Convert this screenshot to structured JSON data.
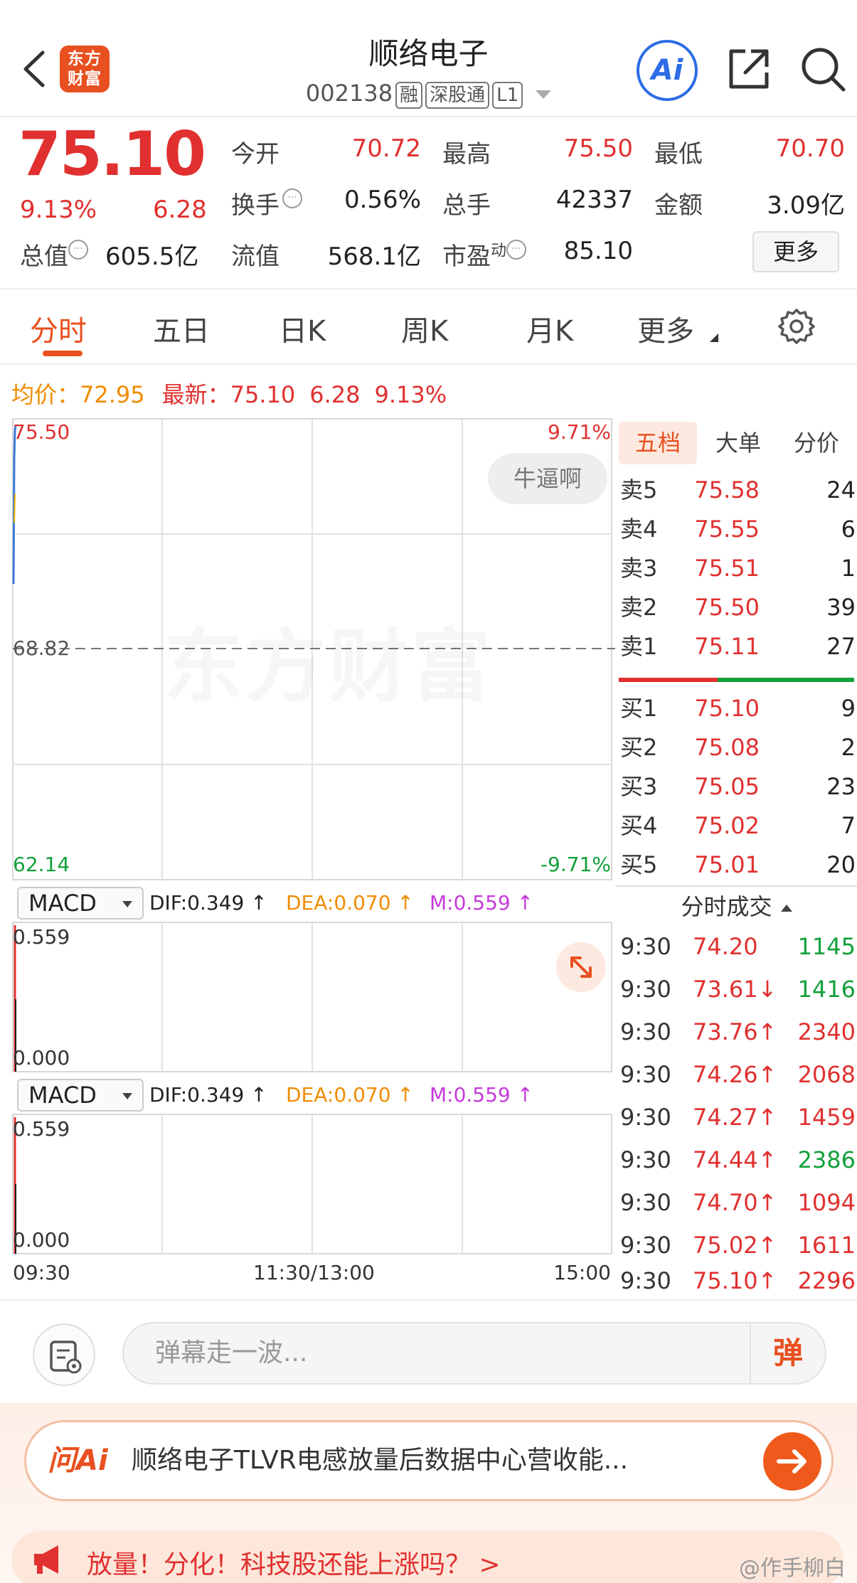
{
  "header": {
    "logo_text": "东方\n财富",
    "logo_line1": "东方",
    "logo_line2": "财富",
    "stock_name": "顺络电子",
    "stock_code": "002138",
    "tags": [
      "融",
      "深股通",
      "L1"
    ],
    "ai_label": "Ai"
  },
  "quote": {
    "price": "75.10",
    "change_pct": "9.13%",
    "change_amt": "6.28",
    "market_cap_label": "总值",
    "market_cap_value": "605.5亿",
    "fields": [
      {
        "label": "今开",
        "value": "70.72",
        "color": "red"
      },
      {
        "label": "最高",
        "value": "75.50",
        "color": "red"
      },
      {
        "label": "最低",
        "value": "70.70",
        "color": "red"
      },
      {
        "label": "换手",
        "value": "0.56%",
        "color": "black"
      },
      {
        "label": "总手",
        "value": "42337",
        "color": "black"
      },
      {
        "label": "金额",
        "value": "3.09亿",
        "color": "black"
      },
      {
        "label": "流值",
        "value": "568.1亿",
        "color": "black"
      },
      {
        "label": "市盈",
        "sup": "动",
        "value": "85.10",
        "color": "black"
      }
    ],
    "more_label": "更多"
  },
  "tabs": [
    "分时",
    "五日",
    "日K",
    "周K",
    "月K",
    "更多"
  ],
  "info_line": {
    "avg_label": "均价：",
    "avg_value": "72.95",
    "latest_label": "最新：",
    "latest_value": "75.10",
    "latest_chg": "6.28",
    "latest_pct": "9.13%"
  },
  "chart": {
    "y_high": "75.50",
    "y_mid": "68.82",
    "y_low": "62.14",
    "pct_high": "9.71%",
    "pct_low": "-9.71%",
    "comment_bubble": "牛逼啊",
    "watermark": "东方财富",
    "x_labels": [
      "09:30",
      "11:30/13:00",
      "15:00"
    ],
    "macd_panels": [
      {
        "name": "MACD",
        "dif": "DIF:0.349 ↑",
        "dea": "DEA:0.070 ↑",
        "m": "M:0.559 ↑",
        "top": "0.559",
        "bottom": "0.000"
      },
      {
        "name": "MACD",
        "dif": "DIF:0.349 ↑",
        "dea": "DEA:0.070 ↑",
        "m": "M:0.559 ↑",
        "top": "0.559",
        "bottom": "0.000"
      }
    ]
  },
  "panel_tabs": [
    "五档",
    "大单",
    "分价"
  ],
  "order_book": {
    "asks": [
      {
        "label": "卖5",
        "price": "75.58",
        "vol": "24"
      },
      {
        "label": "卖4",
        "price": "75.55",
        "vol": "6"
      },
      {
        "label": "卖3",
        "price": "75.51",
        "vol": "1"
      },
      {
        "label": "卖2",
        "price": "75.50",
        "vol": "39"
      },
      {
        "label": "卖1",
        "price": "75.11",
        "vol": "27"
      }
    ],
    "bids": [
      {
        "label": "买1",
        "price": "75.10",
        "vol": "9"
      },
      {
        "label": "买2",
        "price": "75.08",
        "vol": "2"
      },
      {
        "label": "买3",
        "price": "75.05",
        "vol": "23"
      },
      {
        "label": "买4",
        "price": "75.02",
        "vol": "7"
      },
      {
        "label": "买5",
        "price": "75.01",
        "vol": "20"
      }
    ]
  },
  "trades_header": "分时成交",
  "trades": [
    {
      "time": "9:30",
      "price": "74.20",
      "vol": "1145",
      "vol_color": "green"
    },
    {
      "time": "9:30",
      "price": "73.61↓",
      "vol": "1416",
      "vol_color": "green"
    },
    {
      "time": "9:30",
      "price": "73.76↑",
      "vol": "2340",
      "vol_color": "red"
    },
    {
      "time": "9:30",
      "price": "74.26↑",
      "vol": "2068",
      "vol_color": "red"
    },
    {
      "time": "9:30",
      "price": "74.27↑",
      "vol": "1459",
      "vol_color": "red"
    },
    {
      "time": "9:30",
      "price": "74.44↑",
      "vol": "2386",
      "vol_color": "green"
    },
    {
      "time": "9:30",
      "price": "74.70↑",
      "vol": "1094",
      "vol_color": "red"
    },
    {
      "time": "9:30",
      "price": "75.02↑",
      "vol": "1611",
      "vol_color": "red"
    },
    {
      "time": "9:30",
      "price": "75.10↑",
      "vol": "2296",
      "vol_color": "red"
    }
  ],
  "danmaku": {
    "placeholder": "弹幕走一波...",
    "button_label": "弹"
  },
  "ai_banner": {
    "brand": "问Ai",
    "text": "顺络电子TLVR电感放量后数据中心营收能..."
  },
  "news_bar": {
    "text": "放量！分化！科技股还能上涨吗？ >"
  },
  "watermark_handle": "@作手柳白"
}
